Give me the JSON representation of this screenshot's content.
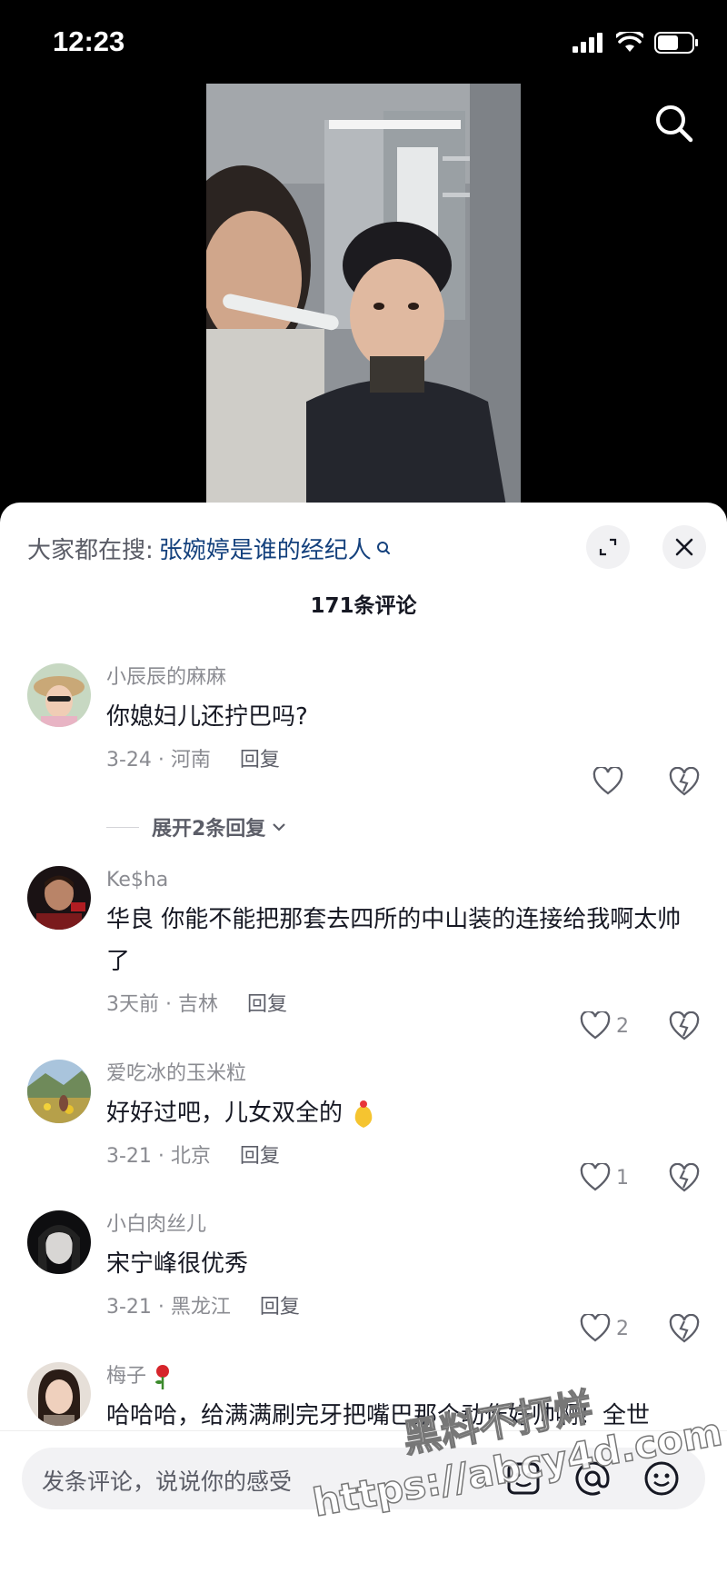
{
  "status_bar": {
    "time": "12:23"
  },
  "search_banner": {
    "prefix": "大家都在搜:",
    "query": "张婉婷是谁的经纪人"
  },
  "comment_count": "171条评论",
  "comments": [
    {
      "user": "小辰辰的麻麻",
      "text": "你媳妇儿还拧巴吗?",
      "date": "3-24 · 河南",
      "reply": "回复",
      "likes": ""
    },
    {
      "user": "Ke$ha",
      "text": "华良 你能不能把那套去四所的中山装的连接给我啊太帅了",
      "date": "3天前 · 吉林",
      "reply": "回复",
      "likes": "2"
    },
    {
      "user": "爱吃冰的玉米粒",
      "text": "好好过吧，儿女双全的",
      "date": "3-21 · 北京",
      "reply": "回复",
      "likes": "1"
    },
    {
      "user": "小白肉丝儿",
      "text": "宋宁峰很优秀",
      "date": "3-21 · 黑龙江",
      "reply": "回复",
      "likes": "2"
    },
    {
      "user": "梅子",
      "text": "哈哈哈，给满满刷完牙把嘴巴那个动作好帅啊！全世",
      "date": "",
      "reply": "",
      "likes": ""
    }
  ],
  "expand_replies": "展开2条回复",
  "input": {
    "placeholder": "发条评论，说说你的感受"
  },
  "watermark": {
    "line1": "黑料不打烊",
    "line2": "https://abcy4d.com"
  },
  "colors": {
    "link": "#14417d",
    "muted": "#8a8b91",
    "sheet_bg": "#ffffff"
  }
}
